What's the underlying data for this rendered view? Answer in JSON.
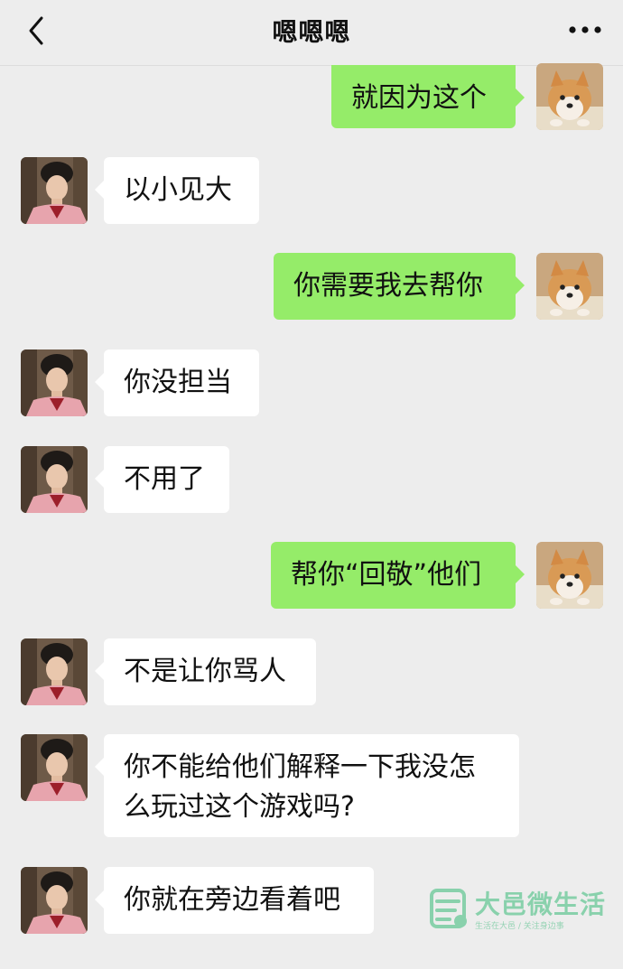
{
  "header": {
    "title": "嗯嗯嗯",
    "back_icon": "chevron-left-icon",
    "more_icon": "more-dots-icon"
  },
  "messages": [
    {
      "side": "out",
      "text": "就因为这个"
    },
    {
      "side": "in",
      "text": "以小见大"
    },
    {
      "side": "out",
      "text": "你需要我去帮你"
    },
    {
      "side": "in",
      "text": "你没担当"
    },
    {
      "side": "in",
      "text": "不用了"
    },
    {
      "side": "out",
      "text": "帮你“回敬”他们"
    },
    {
      "side": "in",
      "text": "不是让你骂人"
    },
    {
      "side": "in",
      "text": "你不能给他们解释一下我没怎么玩过这个游戏吗?"
    },
    {
      "side": "in",
      "text": "你就在旁边看着吧"
    }
  ],
  "watermark": {
    "name": "大邑微生活",
    "slogan": "生活在大邑 / 关注身边事"
  },
  "colors": {
    "background": "#ededed",
    "incoming_bubble": "#ffffff",
    "outgoing_bubble": "#95ec69"
  }
}
